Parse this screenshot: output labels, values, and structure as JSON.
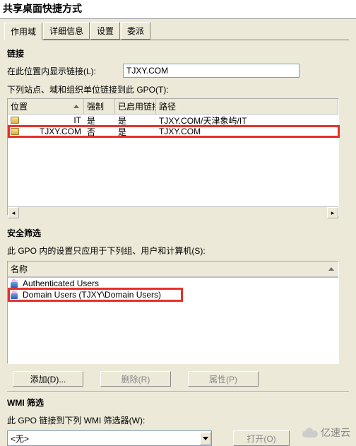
{
  "title": "共享桌面快捷方式",
  "tabs": {
    "scope": "作用域",
    "details": "详细信息",
    "settings": "设置",
    "delegation": "委派"
  },
  "links": {
    "heading": "链接",
    "display_links_label": "在此位置内显示链接(L):",
    "location_value": "TJXY.COM",
    "applies_label": "下列站点、域和组织单位链接到此 GPO(T):",
    "cols": {
      "location": "位置",
      "enforced": "强制",
      "enabled": "已启用链接",
      "path": "路径"
    },
    "rows": [
      {
        "loc": "IT",
        "force": "是",
        "en": "是",
        "path": "TJXY.COM/天津象屿/IT"
      },
      {
        "loc": "TJXY.COM",
        "force": "否",
        "en": "是",
        "path": "TJXY.COM"
      }
    ]
  },
  "security": {
    "heading": "安全筛选",
    "desc": "此 GPO 内的设置只应用于下列组、用户和计算机(S):",
    "name_col": "名称",
    "rows": [
      {
        "name": "Authenticated Users"
      },
      {
        "name": "Domain Users (TJXY\\Domain Users)"
      }
    ]
  },
  "buttons": {
    "add": "添加(D)...",
    "remove": "删除(R)",
    "properties": "属性(P)"
  },
  "wmi": {
    "heading": "WMI 筛选",
    "desc": "此 GPO 链接到下列 WMI 筛选器(W):",
    "selected": "<无>",
    "open": "打开(O)"
  },
  "watermark": "亿速云"
}
